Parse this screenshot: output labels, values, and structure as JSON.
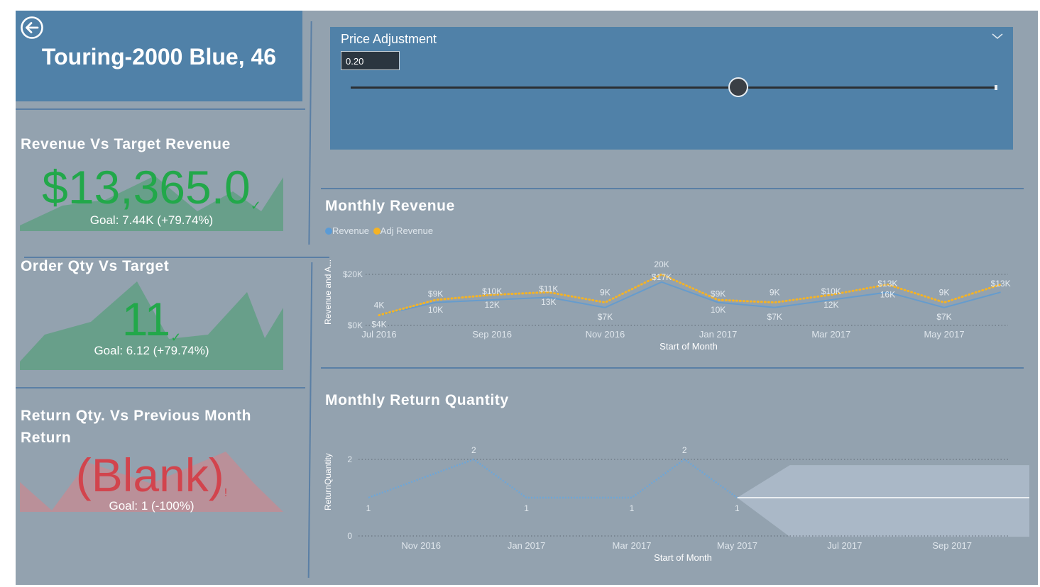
{
  "header": {
    "product_title": "Touring-2000 Blue, 46"
  },
  "kpis": {
    "revenue": {
      "title": "Revenue Vs Target Revenue",
      "value": "$13,365.0",
      "goal": "Goal: 7.44K (+79.74%)",
      "status": "above-goal",
      "color": "#22a84a"
    },
    "order_qty": {
      "title": "Order Qty Vs Target",
      "value": "11",
      "goal": "Goal: 6.12 (+79.74%)",
      "status": "above-goal",
      "color": "#22a84a"
    },
    "return_qty": {
      "title_line1": "Return Qty. Vs Previous Month",
      "title_line2": "Return",
      "value": "(Blank)",
      "goal": "Goal: 1 (-100%)",
      "status": "below-goal",
      "color": "#d2444d"
    }
  },
  "slicer": {
    "title": "Price Adjustment",
    "value": "0.20",
    "fraction": 0.6
  },
  "colors": {
    "revenue": "#5b9bd5",
    "adj_revenue": "#f5b324",
    "canvas": "#93a2af",
    "card": "#5081a8"
  },
  "chart_data": [
    {
      "type": "line",
      "title": "Monthly Revenue",
      "xlabel": "Start of Month",
      "ylabel": "Revenue and A...",
      "categories": [
        "Jul 2016",
        "Aug 2016",
        "Sep 2016",
        "Oct 2016",
        "Nov 2016",
        "Dec 2016",
        "Jan 2017",
        "Feb 2017",
        "Mar 2017",
        "Apr 2017",
        "May 2017",
        "Jun 2017"
      ],
      "x_tick_labels": [
        "Jul 2016",
        "Sep 2016",
        "Nov 2016",
        "Jan 2017",
        "Mar 2017",
        "May 2017"
      ],
      "y_tick_labels": [
        "$0K",
        "$20K"
      ],
      "ylim": [
        0,
        20000
      ],
      "series": [
        {
          "name": "Revenue",
          "values": [
            4000,
            9000,
            10000,
            11000,
            7000,
            17000,
            9000,
            7000,
            10000,
            13000,
            7000,
            13000
          ],
          "labels": [
            "$4K",
            "$9K",
            "$10K",
            "$11K",
            "$7K",
            "$17K",
            "$9K",
            "$7K",
            "$10K",
            "$13K",
            "$7K",
            "$13K"
          ]
        },
        {
          "name": "Adj Revenue",
          "values": [
            4000,
            10000,
            12000,
            13000,
            9000,
            20000,
            10000,
            9000,
            12000,
            16000,
            9000,
            16000
          ],
          "labels": [
            "4K",
            "10K",
            "12K",
            "13K",
            "9K",
            "20K",
            "10K",
            "9K",
            "12K",
            "16K",
            "9K",
            ""
          ]
        }
      ],
      "grid": true,
      "legend": "top-left"
    },
    {
      "type": "line",
      "title": "Monthly Return Quantity",
      "xlabel": "Start of Month",
      "ylabel": "ReturnQuantity",
      "categories": [
        "Oct 2016",
        "Dec 2016",
        "Feb 2017",
        "Apr 2017",
        "May 2017"
      ],
      "x_tick_labels": [
        "Nov 2016",
        "Jan 2017",
        "Mar 2017",
        "May 2017",
        "Jul 2017",
        "Sep 2017"
      ],
      "y_tick_labels": [
        "0",
        "2"
      ],
      "ylim": [
        0,
        2
      ],
      "series": [
        {
          "name": "ReturnQuantity",
          "values": [
            1,
            2,
            1,
            1,
            2,
            1
          ],
          "labels": [
            "1",
            "2",
            "1",
            "1",
            "2",
            "1"
          ]
        }
      ],
      "forecast": {
        "start": "May 2017",
        "end": "Oct 2017",
        "value": 1,
        "band": "shaded"
      },
      "grid": true
    }
  ]
}
